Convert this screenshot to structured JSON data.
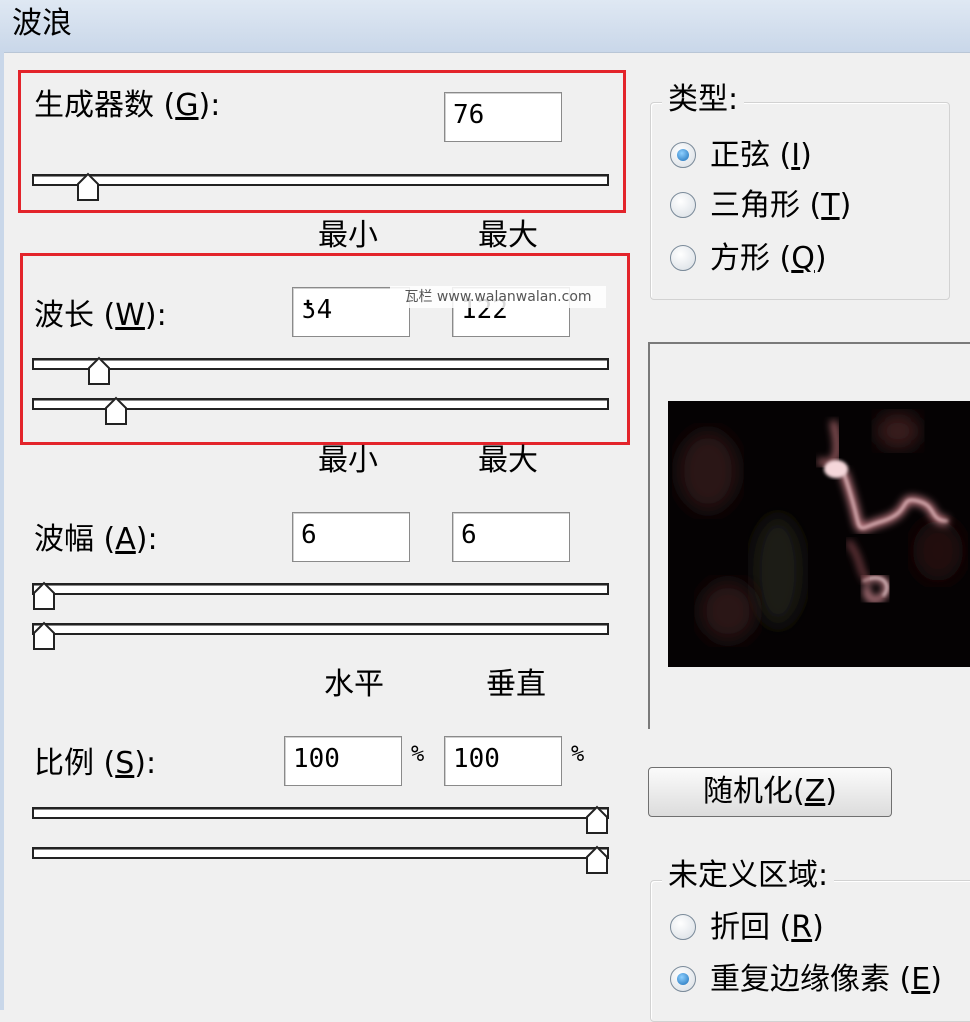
{
  "window": {
    "title": "波浪"
  },
  "generators": {
    "label_text": "生成器数",
    "mnemonic": "G",
    "value": "76",
    "slider_level": 0.08
  },
  "columns": {
    "min": "最小",
    "max": "最大",
    "horizontal": "水平",
    "vertical": "垂直"
  },
  "wavelength": {
    "label_text": "波长",
    "mnemonic": "W",
    "min_value": "24",
    "min_display": "ƾ4",
    "max_value": "122",
    "min_slider_level": 0.1,
    "max_slider_level": 0.13
  },
  "amplitude": {
    "label_text": "波幅",
    "mnemonic": "A",
    "min_value": "6",
    "max_value": "6",
    "min_slider_level": 0.0,
    "max_slider_level": 0.0
  },
  "scale": {
    "label_text": "比例",
    "mnemonic": "S",
    "horizontal_value": "100",
    "vertical_value": "100",
    "unit": "%",
    "horizontal_slider_level": 1.0,
    "vertical_slider_level": 1.0
  },
  "type_group": {
    "title": "类型:",
    "options": [
      {
        "label": "正弦",
        "mnemonic": "I",
        "selected": true
      },
      {
        "label": "三角形",
        "mnemonic": "T",
        "selected": false
      },
      {
        "label": "方形",
        "mnemonic": "Q",
        "selected": false
      }
    ]
  },
  "randomize_button": {
    "label": "随机化",
    "mnemonic": "Z"
  },
  "undefined_area": {
    "title": "未定义区域:",
    "options": [
      {
        "label": "折回",
        "mnemonic": "R",
        "selected": false
      },
      {
        "label": "重复边缘像素",
        "mnemonic": "E",
        "selected": true
      }
    ]
  },
  "watermark": {
    "text": "瓦栏 www.walanwalan.com"
  },
  "colors": {
    "highlight_box": "#e3242b",
    "preview_bg": "#050203"
  }
}
